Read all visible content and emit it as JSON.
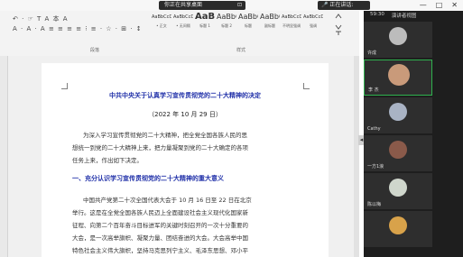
{
  "top_bar": {
    "share_label": "你正在共享桌面",
    "speaking_label": "正在讲话:",
    "window_controls": [
      "—",
      "□",
      "✕"
    ]
  },
  "ribbon": {
    "toolbar_row1": "↶ · ☞ T A 本 A",
    "toolbar_row2": "A · A · A  ≡ ≡ ≡ ≡ ⁝ ≡ · ☆ · ⊞ · ↕",
    "styles": [
      {
        "preview": "AaBbCcDd",
        "name": "• 正文"
      },
      {
        "preview": "AaBbCcDd",
        "name": "• 无间隔"
      },
      {
        "preview": "AaBl",
        "name": "标题 1"
      },
      {
        "preview": "AaBbC",
        "name": "标题 2"
      },
      {
        "preview": "AaBbC",
        "name": "标题"
      },
      {
        "preview": "AaBbC",
        "name": "副标题"
      },
      {
        "preview": "AaBbCcDd",
        "name": "不明显强调"
      },
      {
        "preview": "AaBbCcDd",
        "name": "强调"
      }
    ],
    "group_paragraph": "段落",
    "group_styles": "样式"
  },
  "document": {
    "title": "中共中央关于认真学习宣传贯彻党的二十大精神的决定",
    "date": "（2022 年 10 月 29 日）",
    "intro_lines": [
      "为深入学习宣传贯彻党的二十大精神，把全党全国各族人民的思",
      "想统一到党的二十大精神上来，把力量凝聚到党的二十大确定的各项",
      "任务上来，作出如下决定。"
    ],
    "section_heading": "一、充分认识学习宣传贯彻党的二十大精神的重大意义",
    "section_lines": [
      "中国共产党第二十次全国代表大会于 10 月 16 日至 22 日在北京",
      "举行。这是在全党全国各族人民迈上全面建设社会主义现代化国家新",
      "征程、向第二个百年奋斗目标进军的关键时刻召开的一次十分重要的",
      "大会，是一次高举旗帜、凝聚力量、团结奋进的大会。大会高举中国",
      "特色社会主义伟大旗帜，坚持马克思列宁主义、毛泽东思想、邓小平"
    ]
  },
  "participants_panel": {
    "time": "59:30",
    "view_label": "演讲者视图",
    "participants": [
      {
        "name": "许成",
        "active": false
      },
      {
        "name": "李 杰",
        "active": true
      },
      {
        "name": "Cathy",
        "active": false
      },
      {
        "name": "一方1浪",
        "active": false
      },
      {
        "name": "陈以梅",
        "active": false
      },
      {
        "name": "",
        "active": false
      }
    ]
  },
  "colors": {
    "heading_blue": "#1f2fa8",
    "active_border": "#2fb24e",
    "panel_bg": "#1e1e1e"
  }
}
